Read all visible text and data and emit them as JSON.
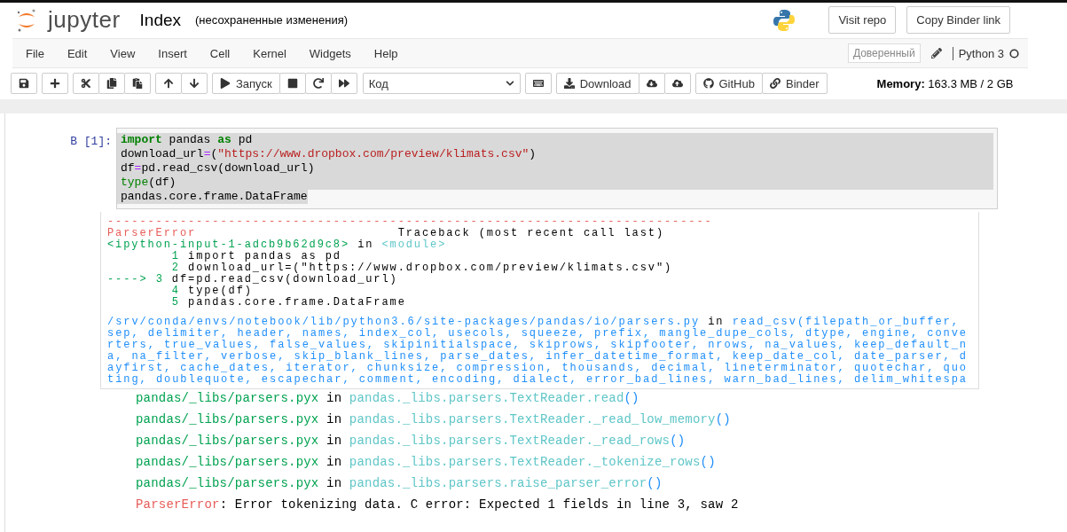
{
  "header": {
    "logo_text": "jupyter",
    "notebook_name": "Index",
    "save_status": "(несохраненные изменения)",
    "buttons": [
      "Visit repo",
      "Copy Binder link"
    ]
  },
  "menubar": {
    "items": [
      "File",
      "Edit",
      "View",
      "Insert",
      "Cell",
      "Kernel",
      "Widgets",
      "Help"
    ],
    "trusted": "Доверенный",
    "kernel_name": "Python 3"
  },
  "toolbar": {
    "groups": [
      [
        {
          "kind": "icon"
        }
      ],
      [
        {
          "kind": "icon"
        }
      ],
      [
        {
          "kind": "icon"
        },
        {
          "kind": "icon"
        },
        {
          "kind": "icon"
        }
      ],
      [
        {
          "kind": "icon"
        },
        {
          "kind": "icon"
        }
      ],
      [
        {
          "kind": "labeled",
          "label": "Запуск"
        },
        {
          "kind": "icon"
        },
        {
          "kind": "icon"
        },
        {
          "kind": "icon"
        }
      ],
      [
        {
          "kind": "select",
          "value": "Код"
        }
      ],
      [
        {
          "kind": "icon"
        }
      ],
      [
        {
          "kind": "labeled",
          "label": "Download"
        },
        {
          "kind": "icon"
        },
        {
          "kind": "icon"
        }
      ],
      [
        {
          "kind": "labeled",
          "label": "GitHub"
        },
        {
          "kind": "labeled",
          "label": "Binder"
        }
      ]
    ],
    "memory": "**Memory:** 163.3 MB / 2 GB"
  },
  "cell": {
    "prompt": "В [1]:",
    "lines": [
      {
        "selected": true,
        "tokens": [
          {
            "kind": "keyword",
            "text": "import"
          },
          {
            "kind": "plain",
            "text": " pandas "
          },
          {
            "kind": "keyword",
            "text": "as"
          },
          {
            "kind": "plain",
            "text": " pd"
          }
        ]
      },
      {
        "selected": true,
        "tokens": [
          {
            "kind": "plain",
            "text": "download_url"
          },
          {
            "kind": "operator",
            "text": "="
          },
          {
            "kind": "plain",
            "text": "("
          },
          {
            "kind": "string",
            "text": "\"https://www.dropbox.com/preview/klimats.csv\""
          },
          {
            "kind": "plain",
            "text": ")"
          }
        ]
      },
      {
        "selected": true,
        "tokens": [
          {
            "kind": "plain",
            "text": "df"
          },
          {
            "kind": "operator",
            "text": "="
          },
          {
            "kind": "plain",
            "text": "pd.read_csv(download_url)"
          }
        ]
      },
      {
        "selected": true,
        "tokens": [
          {
            "kind": "builtin",
            "text": "type"
          },
          {
            "kind": "plain",
            "text": "(df)"
          }
        ]
      },
      {
        "selected": true,
        "tokens": [
          {
            "kind": "plain",
            "text": "pandas.core.frame.DataFrame"
          }
        ]
      }
    ]
  },
  "traceback": {
    "divider": "---------------------------------------------------------------------------",
    "error_name": "ParserError",
    "header": "Traceback (most recent call last)",
    "input_frame": {
      "file": "<ipython-input-1-adcb9b62d9c8>",
      "word": "in",
      "func": "<module>"
    },
    "source_lines": [
      {
        "number": "1",
        "code": "import pandas as pd"
      },
      {
        "number": "2",
        "code": "download_url=(\"https://www.dropbox.com/preview/klimats.csv\")"
      },
      {
        "marker": "---->",
        "number": "3",
        "code": "df=pd.read_csv(download_url)"
      },
      {
        "number": "4",
        "code": "type(df)"
      },
      {
        "number": "5",
        "code": "pandas.core.frame.DataFrame"
      }
    ],
    "location": {
      "path": "/srv/conda/envs/notebook/lib/python3.6/site-packages/pandas/io/parsers.py",
      "word": "in",
      "call": "read_csv(filepath_or_buffer, sep, delimiter, header, names, index_col, usecols, squeeze, prefix, mangle_dupe_cols, dtype, engine, converters, true_values, false_values, skipinitialspace, skiprows, skipfooter, nrows, na_values, keep_default_na, na_filter, verbose, skip_blank_lines, parse_dates, infer_datetime_format, keep_date_col, date_parser, dayfirst, cache_dates, iterator, chunksize, compression, thousands, decimal, lineterminator, quotechar, quoting, doublequote, escapechar, comment, encoding, dialect, error_bad_lines, warn_bad_lines, delim_whitespa"
    },
    "frames": [
      {
        "file": "pandas/_libs/parsers.pyx",
        "word": "in",
        "func": "pandas._libs.parsers.TextReader.read",
        "args": "()"
      },
      {
        "file": "pandas/_libs/parsers.pyx",
        "word": "in",
        "func": "pandas._libs.parsers.TextReader._read_low_memory",
        "args": "()"
      },
      {
        "file": "pandas/_libs/parsers.pyx",
        "word": "in",
        "func": "pandas._libs.parsers.TextReader._read_rows",
        "args": "()"
      },
      {
        "file": "pandas/_libs/parsers.pyx",
        "word": "in",
        "func": "pandas._libs.parsers.TextReader._tokenize_rows",
        "args": "()"
      },
      {
        "file": "pandas/_libs/parsers.pyx",
        "word": "in",
        "func": "pandas._libs.parsers.raise_parser_error",
        "args": "()"
      }
    ],
    "final_error": {
      "name": "ParserError",
      "message": ": Error tokenizing data. C error: Expected 1 fields in line 3, saw 2"
    }
  }
}
